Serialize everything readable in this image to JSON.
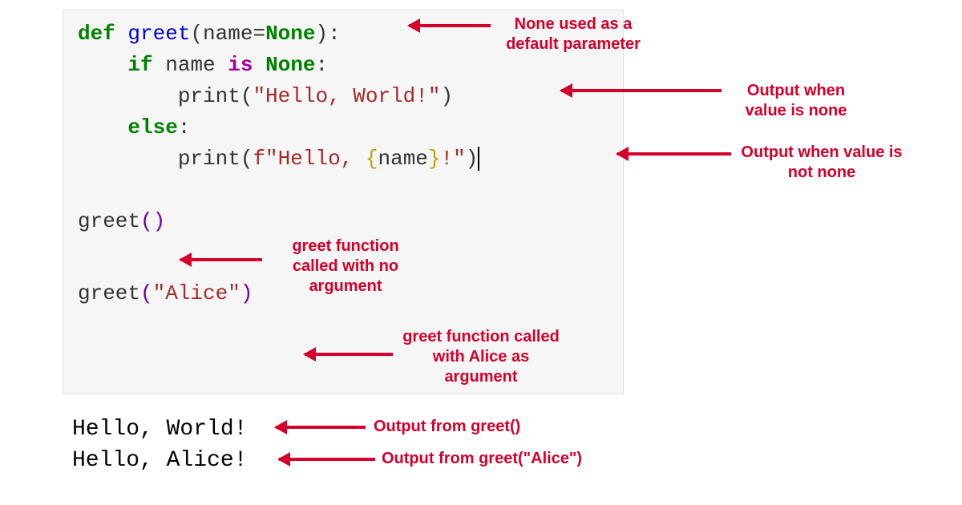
{
  "code": {
    "line1": {
      "def": "def",
      "space1": " ",
      "func": "greet",
      "lparen": "(",
      "param": "name",
      "eq": "=",
      "none": "None",
      "rparen": ")",
      "colon": ":"
    },
    "line2": {
      "indent": "    ",
      "if": "if",
      "space": " ",
      "name": "name",
      "space2": " ",
      "is": "is",
      "space3": " ",
      "none": "None",
      "colon": ":"
    },
    "line3": {
      "indent": "        ",
      "print": "print",
      "lparen": "(",
      "str": "\"Hello, World!\"",
      "rparen": ")"
    },
    "line4": {
      "indent": "    ",
      "else": "else",
      "colon": ":"
    },
    "line5": {
      "indent": "        ",
      "print": "print",
      "lparen": "(",
      "fstr_prefix": "f\"Hello, ",
      "lbrace": "{",
      "name": "name",
      "rbrace": "}",
      "fstr_suffix": "!\"",
      "rparen": ")"
    },
    "line6": {
      "func": "greet",
      "lparen": "(",
      "rparen": ")"
    },
    "line7": {
      "func": "greet",
      "lparen": "(",
      "str": "\"Alice\"",
      "rparen": ")"
    }
  },
  "output": {
    "line1": "Hello, World!",
    "line2": "Hello, Alice!"
  },
  "annotations": {
    "a1": "None used as a default parameter",
    "a2": "Output when value is none",
    "a3": "Output when value is not none",
    "a4": "greet function called with no argument",
    "a5": "greet function called with Alice as argument",
    "a6": "Output from greet()",
    "a7": "Output from greet(\"Alice\")"
  }
}
